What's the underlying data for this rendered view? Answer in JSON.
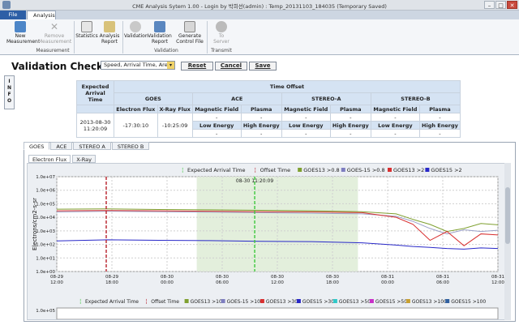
{
  "window": {
    "title": "CME Analysis Sytem 1.00 - Login by 박희선(admin) : Temp_20131103_184035 (Temporary Saved)"
  },
  "ribbon_tabs": [
    "File",
    "Analysis"
  ],
  "ribbon": {
    "new_measurement": "New\nMeasurement",
    "remove_measurement": "Remove\nMeasurement",
    "statistics": "Statistics",
    "analysis_report": "Analysis\nReport",
    "validation": "Validation",
    "validation_report": "Validation\nReport",
    "generate_control_file": "Generate\nControl File",
    "to_server": "To\nServer",
    "group_measurement": "Measurement",
    "group_validation": "Validation",
    "group_transmit": "Transmit"
  },
  "validation": {
    "title": "Validation Check",
    "select_value": "Speed, Arrival Time, Area",
    "reset": "Reset",
    "cancel": "Cancel",
    "save": "Save"
  },
  "info_label": "I\nN\nF\nO",
  "offset_table": {
    "time_offset": "Time Offset",
    "expected_arrival": "Expected\nArrival\nTime",
    "groups": [
      "GOES",
      "ACE",
      "STEREO-A",
      "STEREO-B"
    ],
    "sub": [
      "Electron Flux",
      "X-Ray Flux",
      "Magnetic Field",
      "Plasma",
      "Magnetic Field",
      "Plasma",
      "Magnetic Field",
      "Plasma"
    ],
    "arrival_value": "2013-08-30\n11:20:09",
    "goes_values": [
      "-17:30:10",
      "-10:25:09"
    ],
    "dash": "-",
    "energy": [
      "Low Energy",
      "High Energy",
      "Low Energy",
      "High Energy",
      "Low Energy",
      "High Energy"
    ]
  },
  "source_tabs": [
    "GOES",
    "ACE",
    "STEREO A",
    "STEREO B"
  ],
  "inner_tabs": [
    "Electron Flux",
    "X-Ray"
  ],
  "chart_data": {
    "type": "line",
    "title": "",
    "ylabel": "Electrons/cm2-s-sr",
    "ylog": true,
    "ylim": [
      1,
      10000000
    ],
    "y_ticks": [
      "1.0e+07",
      "1.0e+06",
      "1.0e+05",
      "1.0e+04",
      "1.0e+03",
      "1.0e+02",
      "1.0e+01",
      "1.0e+00"
    ],
    "x_ticks": [
      "08-29\n12:00",
      "08-29\n18:00",
      "08-30\n00:00",
      "08-30\n06:00",
      "08-30\n12:00",
      "08-30\n18:00",
      "08-31\n00:00",
      "08-31\n06:00",
      "08-31\n12:00"
    ],
    "x_range_hours": [
      0,
      52
    ],
    "expected_arrival_hour": 23.33,
    "expected_arrival_label": "08-30 11:20:09",
    "offset_time_hour": 5.83,
    "shaded_hours": [
      16.5,
      35.5
    ],
    "legend": [
      "Expected Arrival Time",
      "Offset Time",
      "GOES13 >0.8",
      "GOES-15 >0.8",
      "GOES13 >2",
      "GOES15 >2"
    ],
    "legend_colors": [
      "#3cc83c",
      "#b8202a",
      "#7fa030",
      "#7e7ec0",
      "#d83030",
      "#2828c8"
    ],
    "series": [
      {
        "name": "GOES13 >0.8",
        "color": "#7fa030",
        "hours": [
          0,
          6,
          12,
          18,
          24,
          30,
          36,
          40,
          42,
          44,
          46,
          48,
          50,
          52
        ],
        "values": [
          40000,
          42000,
          38000,
          36000,
          33000,
          30000,
          26000,
          18000,
          7000,
          3000,
          900,
          1500,
          3500,
          2800
        ]
      },
      {
        "name": "GOES-15 >0.8",
        "color": "#9aa0c8",
        "hours": [
          0,
          6,
          12,
          18,
          24,
          30,
          36,
          40,
          42,
          44,
          46,
          48,
          50,
          52
        ],
        "values": [
          25000,
          28000,
          26000,
          24000,
          22000,
          20000,
          18000,
          12000,
          5000,
          1500,
          600,
          1200,
          900,
          1100
        ]
      },
      {
        "name": "GOES13 >2",
        "color": "#d83030",
        "hours": [
          0,
          6,
          12,
          18,
          24,
          30,
          36,
          40,
          42,
          44,
          46,
          48,
          50,
          52
        ],
        "values": [
          30000,
          32000,
          30000,
          28000,
          26000,
          25000,
          22000,
          10000,
          3000,
          200,
          900,
          80,
          600,
          500
        ]
      },
      {
        "name": "GOES15 >2",
        "color": "#2828c8",
        "hours": [
          0,
          6,
          12,
          18,
          24,
          30,
          36,
          40,
          42,
          44,
          46,
          48,
          50,
          52
        ],
        "values": [
          180,
          220,
          200,
          190,
          170,
          160,
          130,
          90,
          70,
          60,
          50,
          45,
          55,
          50
        ]
      }
    ]
  },
  "legend2": [
    "Expected Arrival Time",
    "Offset Time",
    "GOES13 >10",
    "GOES-15 >10",
    "GOES13 >30",
    "GOES15 >30",
    "GOES13 >50",
    "GOES15 >50",
    "GOES13 >100",
    "GOES15 >100"
  ],
  "legend2_colors": [
    "#3cc83c",
    "#b8202a",
    "#7fa030",
    "#7e7ec0",
    "#d83030",
    "#2828c8",
    "#30c8c8",
    "#c830c8",
    "#c8a030",
    "#3060a0"
  ],
  "chart2_tick": "1.0e+05"
}
